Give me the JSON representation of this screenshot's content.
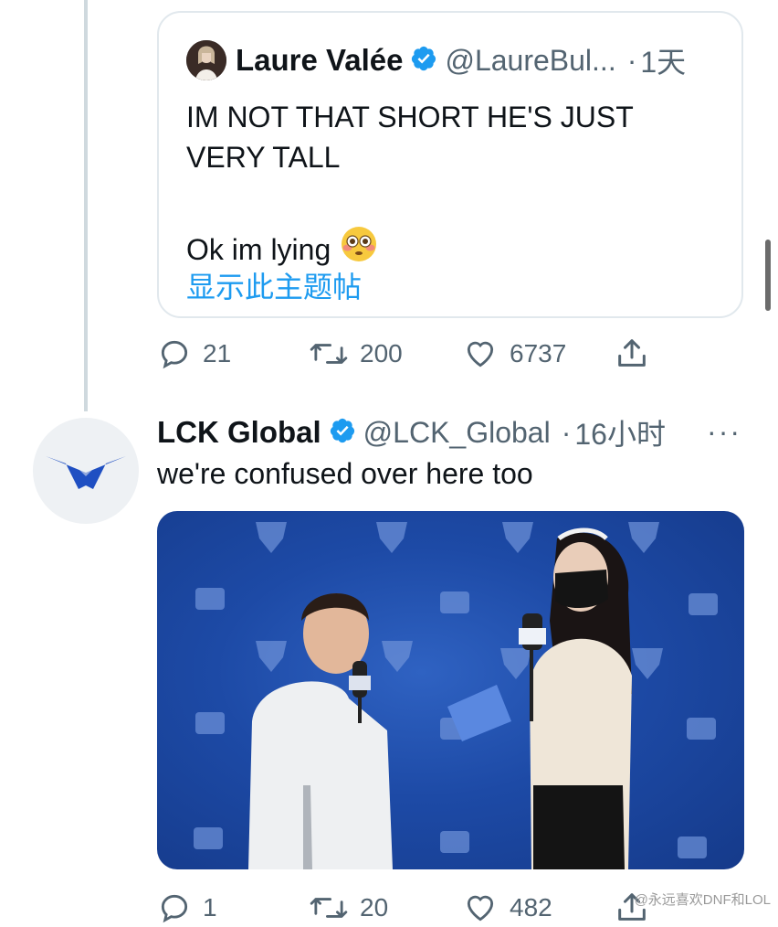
{
  "quoted_tweet": {
    "author_name": "Laure Valée",
    "handle": "@LaureBul...",
    "separator": "·",
    "time": "1天",
    "text_line1": "IM NOT THAT SHORT HE'S JUST",
    "text_line2": "VERY TALL",
    "text_line3": "Ok im lying",
    "emoji": "flushed-face-emoji",
    "show_thread": "显示此主题帖",
    "replies": "21",
    "retweets": "200",
    "likes": "6737"
  },
  "tweet": {
    "author_name": "LCK Global",
    "handle": "@LCK_Global",
    "separator": "·",
    "time": "16小时",
    "more_label": "···",
    "text": "we're confused over here too",
    "media": "interview-photo",
    "replies": "1",
    "retweets": "20",
    "likes": "482"
  },
  "watermark": "@永远喜欢DNF和LOL",
  "colors": {
    "link": "#1d9bf0",
    "verified": "#1d9bf0",
    "secondary_text": "#536471",
    "logo_blue": "#1f4fc2"
  }
}
